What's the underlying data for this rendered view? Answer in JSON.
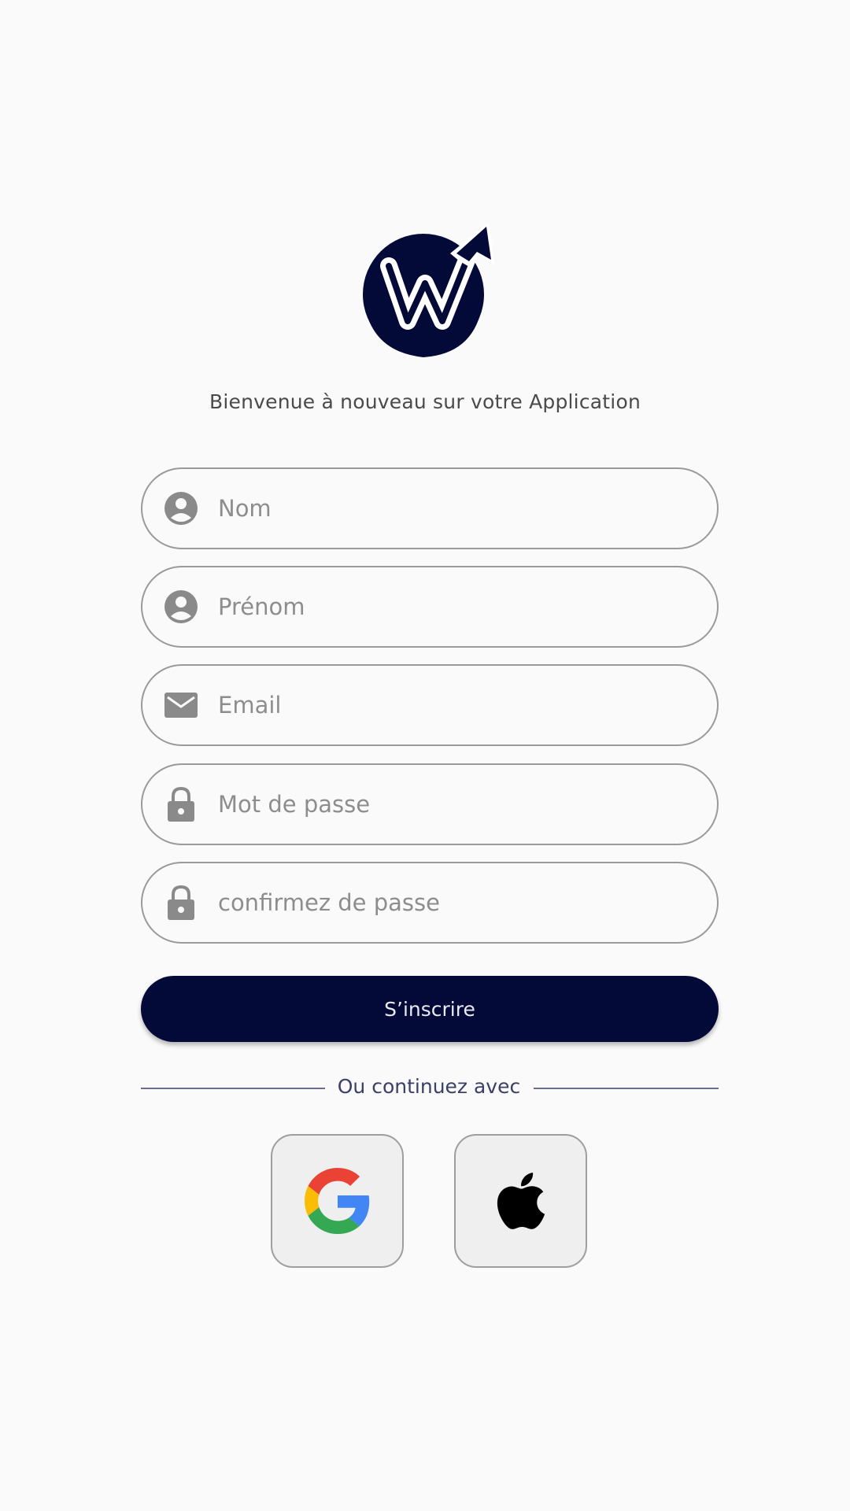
{
  "header": {
    "logo_icon": "w-growth-arrow-logo",
    "welcome_text": "Bienvenue à nouveau sur votre Application"
  },
  "form": {
    "fields": [
      {
        "placeholder": "Nom",
        "icon": "person-icon",
        "value": ""
      },
      {
        "placeholder": "Prénom",
        "icon": "person-icon",
        "value": ""
      },
      {
        "placeholder": "Email",
        "icon": "envelope-icon",
        "value": ""
      },
      {
        "placeholder": "Mot de passe",
        "icon": "lock-icon",
        "value": ""
      },
      {
        "placeholder": "confirmez de passe",
        "icon": "lock-icon",
        "value": ""
      }
    ],
    "submit_label": "S’inscrire"
  },
  "social": {
    "divider_text": "Ou continuez avec",
    "providers": [
      {
        "name": "Google",
        "icon": "google-icon"
      },
      {
        "name": "Apple",
        "icon": "apple-icon"
      }
    ]
  },
  "colors": {
    "primary": "#030a38",
    "border": "#9a9a9a",
    "placeholder": "#8d8d8d",
    "background": "#fafafa"
  }
}
